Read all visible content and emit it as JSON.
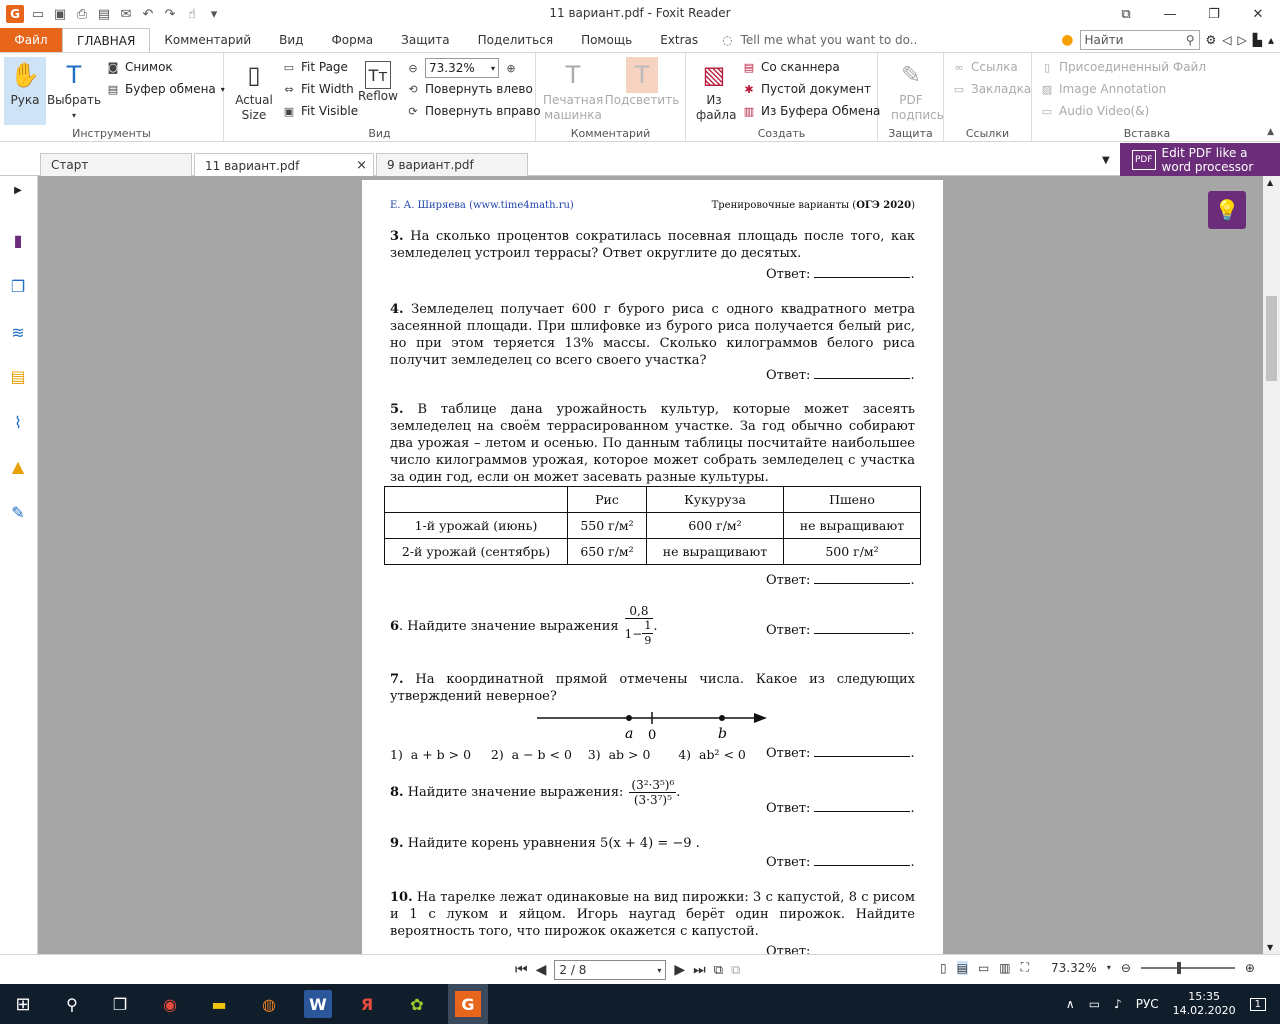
{
  "window": {
    "title": "11 вариант.pdf - Foxit Reader"
  },
  "ribbon_tabs": {
    "file": "Файл",
    "tabs": [
      "ГЛАВНАЯ",
      "Комментарий",
      "Вид",
      "Форма",
      "Защита",
      "Поделиться",
      "Помощь",
      "Extras"
    ],
    "tell_me": "Tell me what you want to do..",
    "search_placeholder": "Найти"
  },
  "ribbon": {
    "tools": {
      "hand": "Рука",
      "select": "Выбрать",
      "snapshot": "Снимок",
      "clipboard": "Буфер обмена",
      "label": "Инструменты"
    },
    "view": {
      "actual_size": "Actual Size",
      "fit_page": "Fit Page",
      "fit_width": "Fit Width",
      "fit_visible": "Fit Visible",
      "reflow": "Reflow",
      "zoom": "73.32%",
      "rotate_left": "Повернуть влево",
      "rotate_right": "Повернуть вправо",
      "label": "Вид"
    },
    "comment": {
      "typewriter": "Печатная машинка",
      "highlight": "Подсветить",
      "label": "Комментарий"
    },
    "create": {
      "from_file": "Из файла",
      "from_scanner": "Со сканнера",
      "blank": "Пустой документ",
      "from_clipboard": "Из Буфера Обмена",
      "label": "Создать"
    },
    "protect": {
      "sign": "PDF подпись",
      "label": "Защита"
    },
    "links": {
      "link": "Ссылка",
      "bookmark": "Закладка",
      "label": "Ссылки"
    },
    "insert": {
      "attached": "Присоединенный Файл",
      "image_annotation": "Image Annotation",
      "audio_video": "Audio  Video(&)",
      "label": "Вставка"
    }
  },
  "doc_tabs": [
    {
      "label": "Старт"
    },
    {
      "label": "11 вариант.pdf",
      "close": "×"
    },
    {
      "label": "9 вариант.pdf"
    }
  ],
  "promo": {
    "line1": "Edit PDF like a",
    "line2": "word processor"
  },
  "page": {
    "header_left": "Е. А. Ширяева (www.time4math.ru)",
    "header_right_prefix": "Тренировочные варианты (",
    "header_right_bold": "ОГЭ 2020",
    "header_right_suffix": ")",
    "answer_label": "Ответ:",
    "q3_num": "3.",
    "q3": "На сколько процентов сократилась посевная площадь после того, как земледелец устроил террасы? Ответ округлите до десятых.",
    "q4_num": "4.",
    "q4": "Земледелец получает 600 г бурого риса с одного квадратного метра засеянной площади. При шлифовке из бурого риса получается белый рис, но при этом теряется 13% массы. Сколько килограммов белого риса получит земледелец со всего своего участка?",
    "q5_num": "5.",
    "q5": "В таблице дана урожайность культур, которые может засеять земледелец на своём террасированном участке. За год обычно собирают два урожая – летом и осенью. По данным таблицы посчитайте наибольшее число килограммов урожая, которое может собрать земледелец с участка за один год, если он может засевать разные культуры.",
    "table_header": [
      "",
      "Рис",
      "Кукуруза",
      "Пшено"
    ],
    "table_rows": [
      [
        "1-й урожай (июнь)",
        "550 г/м²",
        "600 г/м²",
        "не выращивают"
      ],
      [
        "2-й урожай (сентябрь)",
        "650 г/м²",
        "не выращивают",
        "500 г/м²"
      ]
    ],
    "q6_num": "6",
    "q6": ". Найдите значение выражения",
    "q6_num_frac": "0,8",
    "q6_den_a": "1−",
    "q6_den_n": "1",
    "q6_den_d": "9",
    "q7_num": "7.",
    "q7": "На координатной прямой отмечены числа. Какое из следующих утверждений неверное?",
    "q7_labels": {
      "a": "a",
      "zero": "0",
      "b": "b"
    },
    "q7_options": "1)  a + b > 0     2)  a − b < 0    3)  ab > 0       4)  ab² < 0",
    "q8_num": "8.",
    "q8": "Найдите значение выражения:",
    "q8_num_frac": "(3²·3⁵)⁶",
    "q8_den_frac": "(3·3⁷)⁵",
    "q9_num": "9.",
    "q9": "Найдите корень уравнения  5(x + 4) = −9 .",
    "q10_num": "10.",
    "q10": "На тарелке лежат одинаковые на вид пирожки: 3 с капустой, 8 с рисом и 1 с луком и яйцом. Игорь наугад берёт один пирожок. Найдите вероятность того, что пирожок окажется с капустой."
  },
  "statusbar": {
    "page": "2 / 8",
    "zoom": "73.32%"
  },
  "taskbar": {
    "lang": "РУС",
    "time": "15:35",
    "date": "14.02.2020",
    "notif": "1"
  }
}
